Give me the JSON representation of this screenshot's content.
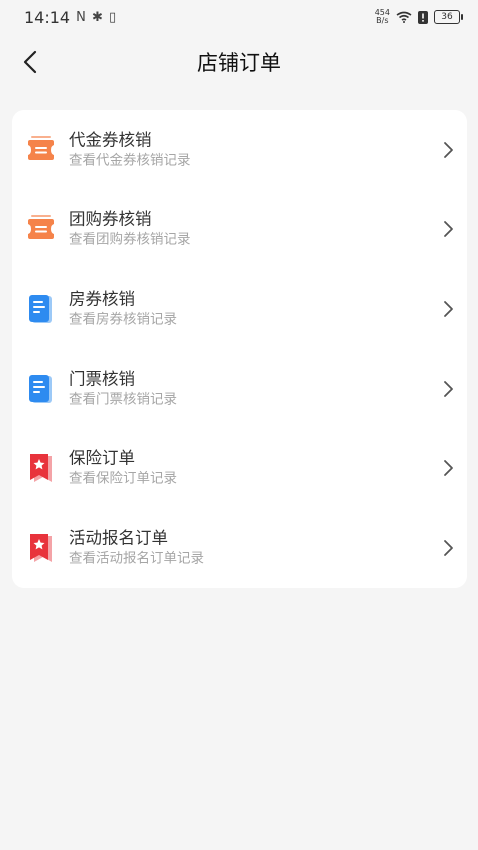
{
  "status": {
    "time": "14:14",
    "left_glyphs": "N ✱ ▯",
    "net_speed_top": "454",
    "net_speed_bottom": "B/s",
    "battery": "36"
  },
  "header": {
    "title": "店铺订单"
  },
  "items": [
    {
      "label": "代金券核销",
      "sub": "查看代金券核销记录",
      "icon": "ticket-icon"
    },
    {
      "label": "团购券核销",
      "sub": "查看团购券核销记录",
      "icon": "ticket-icon"
    },
    {
      "label": "房券核销",
      "sub": "查看房券核销记录",
      "icon": "document-icon"
    },
    {
      "label": "门票核销",
      "sub": "查看门票核销记录",
      "icon": "document-icon"
    },
    {
      "label": "保险订单",
      "sub": "查看保险订单记录",
      "icon": "star-bookmark-icon"
    },
    {
      "label": "活动报名订单",
      "sub": "查看活动报名订单记录",
      "icon": "star-bookmark-icon"
    }
  ],
  "colors": {
    "ticket": "#f5834a",
    "document": "#2e8bf0",
    "bookmark": "#e8333c",
    "background": "#f5f5f5"
  }
}
